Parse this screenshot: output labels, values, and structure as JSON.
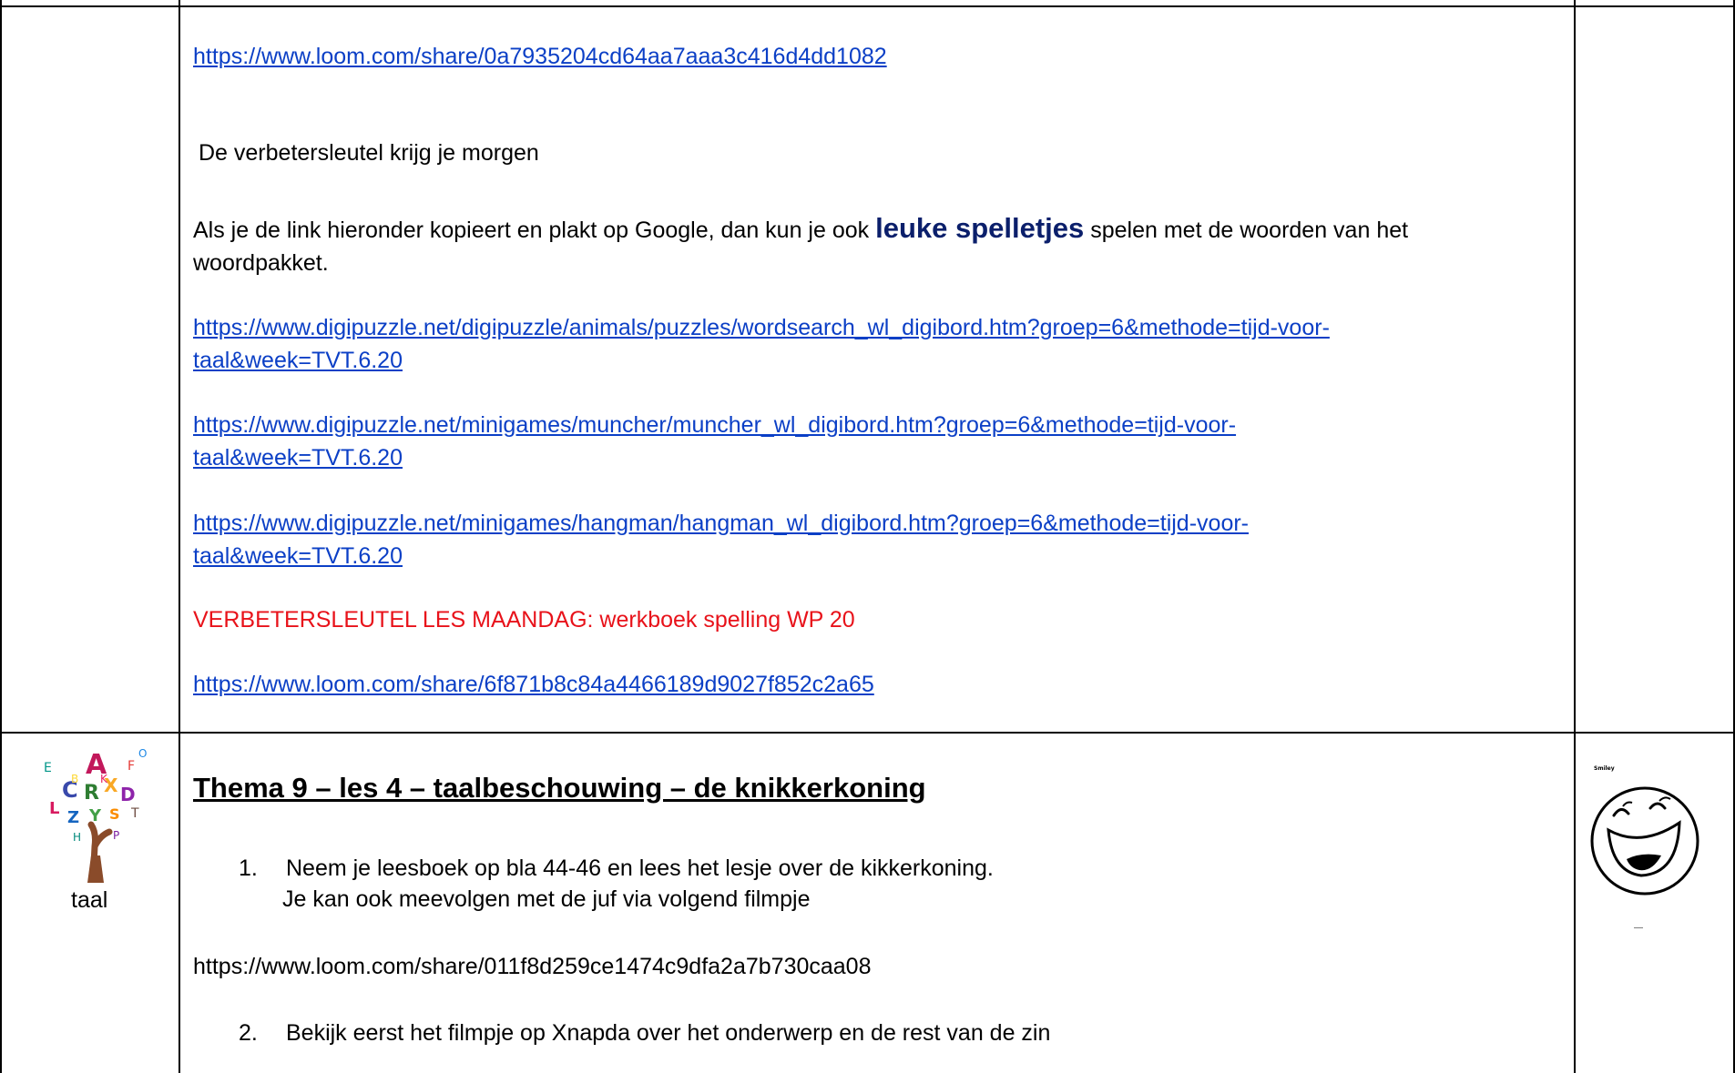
{
  "top_row": {
    "link_1": "https://www.loom.com/share/0a7935204cd64aa7aaa3c416d4dd1082",
    "note_key_tomorrow": "De verbetersleutel krijg je morgen",
    "games_intro_before": "Als je de link hieronder kopieert en plakt op Google, dan  kun je ook ",
    "games_intro_bold": "leuke spelletjes",
    "games_intro_after": " spelen met de woorden van het",
    "games_intro_line2": "woordpakket.",
    "game_links": [
      {
        "line1": "https://www.digipuzzle.net/digipuzzle/animals/puzzles/wordsearch_wl_digibord.htm?groep=6&methode=tijd-voor-",
        "line2": "taal&week=TVT.6.20"
      },
      {
        "line1": "https://www.digipuzzle.net/minigames/muncher/muncher_wl_digibord.htm?groep=6&methode=tijd-voor-",
        "line2": "taal&week=TVT.6.20"
      },
      {
        "line1": "https://www.digipuzzle.net/minigames/hangman/hangman_wl_digibord.htm?groep=6&methode=tijd-voor-",
        "line2": "taal&week=TVT.6.20"
      }
    ],
    "answer_key_label": "VERBETERSLEUTEL LES MAANDAG: werkboek spelling WP 20",
    "link_2": "https://www.loom.com/share/6f871b8c84a4466189d9027f852c2a65"
  },
  "bottom_row": {
    "subject_label": "taal",
    "heading": "Thema 9 – les 4 – taalbeschouwing – de knikkerkoning",
    "steps": [
      {
        "num": "1.",
        "line1": "Neem je leesboek op bla 44-46 en lees het lesje over de kikkerkoning.",
        "line2": "Je kan ook meevolgen met de juf via volgend filmpje"
      },
      {
        "num": "2.",
        "line1": "Bekijk eerst het filmpje op Xnapda over het onderwerp en de rest van de zin"
      }
    ],
    "video_url": "https://www.loom.com/share/011f8d259ce1474c9dfa2a7b730caa08",
    "smiley_caption": "Smiley"
  },
  "colors": {
    "link": "#0b3fc6",
    "red_text": "#e8121a",
    "heading_blue": "#0b1f6b",
    "border": "#000000"
  }
}
